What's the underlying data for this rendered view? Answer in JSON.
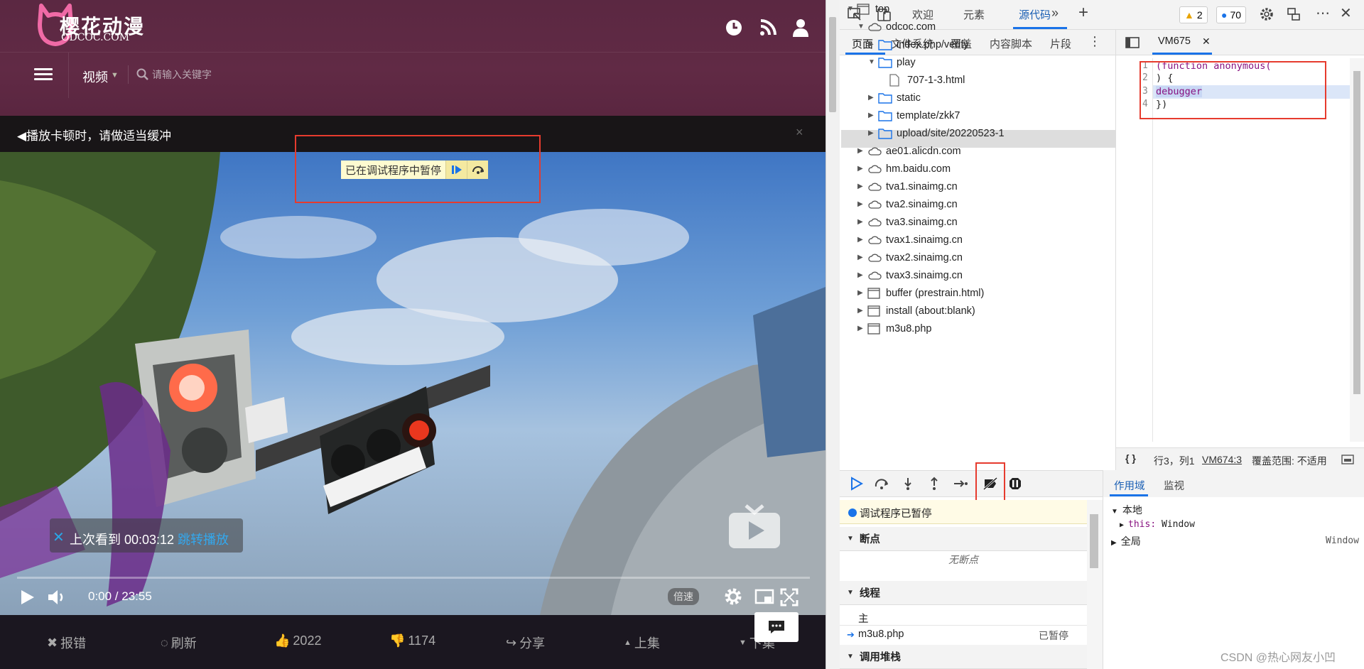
{
  "site": {
    "logo_title": "樱花动漫",
    "logo_sub": "ODCOC.COM",
    "category": "视频",
    "search_placeholder": "请输入关键字",
    "notice": "◀播放卡顿时，请做适当缓冲",
    "notice_close": "×",
    "debugger_paused_overlay": "已在调试程序中暂停",
    "resume_text": "上次看到 00:03:12",
    "resume_jump": "跳转播放",
    "time": "0:00 / 23:55",
    "rate": "倍速",
    "actions": [
      {
        "icon": "close-icon",
        "label": "报错"
      },
      {
        "icon": "refresh-icon",
        "label": "刷新"
      },
      {
        "icon": "thumbs-up-icon",
        "label": "2022"
      },
      {
        "icon": "thumbs-down-icon",
        "label": "1174"
      },
      {
        "icon": "share-icon",
        "label": "分享"
      },
      {
        "icon": "caret-up-icon",
        "label": "上集"
      },
      {
        "icon": "caret-down-icon",
        "label": "下集"
      }
    ]
  },
  "devtools": {
    "top_tabs": [
      "欢迎",
      "元素",
      "源代码"
    ],
    "active_tab": "源代码",
    "warnings": "2",
    "messages": "70",
    "sub_tabs": [
      "页面",
      "文件系统",
      "覆盖",
      "内容脚本",
      "片段"
    ],
    "tree": [
      {
        "label": "top",
        "type": "frame",
        "depth": 0,
        "open": true
      },
      {
        "label": "odcoc.com",
        "type": "cloud",
        "depth": 1,
        "open": true
      },
      {
        "label": "index.php/verify",
        "type": "folder",
        "depth": 2,
        "open": false
      },
      {
        "label": "play",
        "type": "folder",
        "depth": 2,
        "open": true
      },
      {
        "label": "707-1-3.html",
        "type": "file",
        "depth": 3,
        "selected": true
      },
      {
        "label": "static",
        "type": "folder",
        "depth": 2,
        "open": false
      },
      {
        "label": "template/zkk7",
        "type": "folder",
        "depth": 2,
        "open": false
      },
      {
        "label": "upload/site/20220523-1",
        "type": "folder",
        "depth": 2,
        "open": false
      },
      {
        "label": "ae01.alicdn.com",
        "type": "cloud",
        "depth": 1,
        "open": false
      },
      {
        "label": "hm.baidu.com",
        "type": "cloud",
        "depth": 1,
        "open": false
      },
      {
        "label": "tva1.sinaimg.cn",
        "type": "cloud",
        "depth": 1,
        "open": false
      },
      {
        "label": "tva2.sinaimg.cn",
        "type": "cloud",
        "depth": 1,
        "open": false
      },
      {
        "label": "tva3.sinaimg.cn",
        "type": "cloud",
        "depth": 1,
        "open": false
      },
      {
        "label": "tvax1.sinaimg.cn",
        "type": "cloud",
        "depth": 1,
        "open": false
      },
      {
        "label": "tvax2.sinaimg.cn",
        "type": "cloud",
        "depth": 1,
        "open": false
      },
      {
        "label": "tvax3.sinaimg.cn",
        "type": "cloud",
        "depth": 1,
        "open": false
      },
      {
        "label": "buffer (prestrain.html)",
        "type": "frame",
        "depth": 1,
        "open": false
      },
      {
        "label": "install (about:blank)",
        "type": "frame",
        "depth": 1,
        "open": false
      },
      {
        "label": "m3u8.php",
        "type": "frame",
        "depth": 1,
        "open": false
      }
    ],
    "editor_tab": "VM675",
    "code_lines": [
      {
        "n": "1",
        "code": "(function anonymous("
      },
      {
        "n": "2",
        "code": ") {"
      },
      {
        "n": "3",
        "code": "debugger"
      },
      {
        "n": "4",
        "code": "})"
      }
    ],
    "status_braces": "{ }",
    "status_pos": "行3，列1",
    "status_link": "VM674:3",
    "status_coverage": "覆盖范围: 不适用",
    "paused_banner": "调试程序已暂停",
    "breakpoints_title": "断点",
    "no_breakpoints": "无断点",
    "threads_title": "线程",
    "thread_main": "主",
    "thread_frame": "m3u8.php",
    "thread_state": "已暂停",
    "callstack_title": "调用堆栈",
    "scope_tabs": [
      "作用域",
      "监视"
    ],
    "scope_local": "本地",
    "scope_this_key": "this:",
    "scope_this_val": "Window",
    "scope_global": "全局",
    "scope_global_val": "Window"
  },
  "watermark": "CSDN @热心网友小凹"
}
